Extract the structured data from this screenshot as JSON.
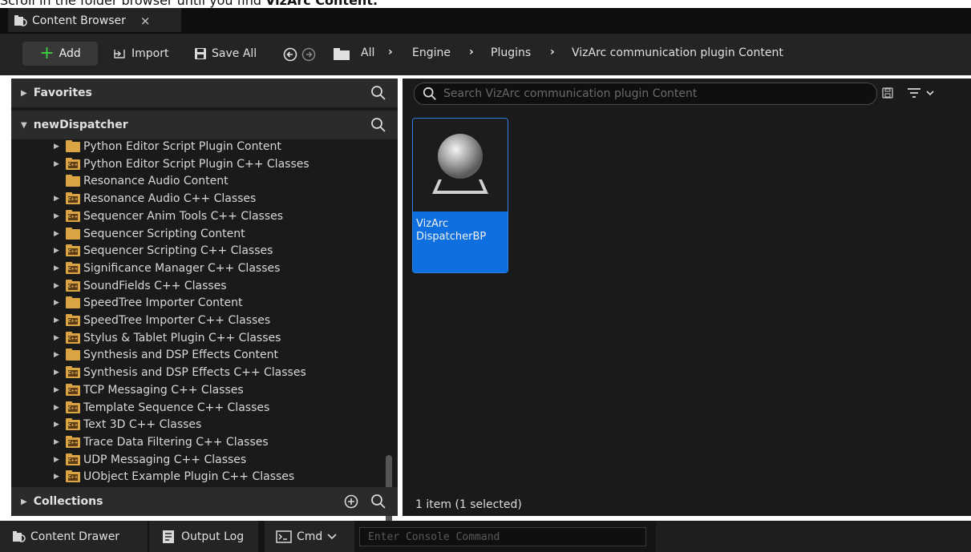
{
  "instruction": {
    "text_prefix": "Scroll in the folder browser until you find ",
    "text_bold": "VizArc Content."
  },
  "tab": {
    "title": "Content Browser",
    "close": "×"
  },
  "toolbar": {
    "add_label": "Add",
    "import_label": "Import",
    "save_all_label": "Save All"
  },
  "breadcrumb": [
    "All",
    "Engine",
    "Plugins",
    "VizArc communication plugin Content"
  ],
  "left_panel": {
    "favorites_label": "Favorites",
    "project_label": "newDispatcher",
    "collections_label": "Collections",
    "tree_items": [
      {
        "label": "Python Editor Script Plugin Content",
        "type": "folder",
        "expandable": true
      },
      {
        "label": "Python Editor Script Plugin C++ Classes",
        "type": "cpp",
        "expandable": true
      },
      {
        "label": "Resonance Audio Content",
        "type": "folder",
        "expandable": false
      },
      {
        "label": "Resonance Audio C++ Classes",
        "type": "cpp",
        "expandable": true
      },
      {
        "label": "Sequencer Anim Tools C++ Classes",
        "type": "cpp",
        "expandable": true
      },
      {
        "label": "Sequencer Scripting Content",
        "type": "folder",
        "expandable": true
      },
      {
        "label": "Sequencer Scripting C++ Classes",
        "type": "cpp",
        "expandable": true
      },
      {
        "label": "Significance Manager C++ Classes",
        "type": "cpp",
        "expandable": true
      },
      {
        "label": "SoundFields C++ Classes",
        "type": "cpp",
        "expandable": true
      },
      {
        "label": "SpeedTree Importer Content",
        "type": "folder",
        "expandable": true
      },
      {
        "label": "SpeedTree Importer C++ Classes",
        "type": "cpp",
        "expandable": true
      },
      {
        "label": "Stylus & Tablet Plugin C++ Classes",
        "type": "cpp",
        "expandable": true
      },
      {
        "label": "Synthesis and DSP Effects Content",
        "type": "folder",
        "expandable": true
      },
      {
        "label": "Synthesis and DSP Effects C++ Classes",
        "type": "cpp",
        "expandable": true
      },
      {
        "label": "TCP Messaging C++ Classes",
        "type": "cpp",
        "expandable": true
      },
      {
        "label": "Template Sequence C++ Classes",
        "type": "cpp",
        "expandable": true
      },
      {
        "label": "Text 3D C++ Classes",
        "type": "cpp",
        "expandable": true
      },
      {
        "label": "Trace Data Filtering C++ Classes",
        "type": "cpp",
        "expandable": true
      },
      {
        "label": "UDP Messaging C++ Classes",
        "type": "cpp",
        "expandable": true
      },
      {
        "label": "UObject Example Plugin C++ Classes",
        "type": "cpp",
        "expandable": true
      }
    ]
  },
  "right_panel": {
    "search_placeholder": "Search VizArc communication plugin Content",
    "asset_name_line1": "VizArc",
    "asset_name_line2": "DispatcherBP",
    "status": "1 item (1 selected)"
  },
  "bottom_bar": {
    "content_drawer": "Content Drawer",
    "output_log": "Output Log",
    "cmd": "Cmd",
    "console_placeholder": "Enter Console Command"
  },
  "colors": {
    "accent": "#0e6fe0",
    "add_plus": "#3ecf3e",
    "folder": "#d9a441"
  }
}
